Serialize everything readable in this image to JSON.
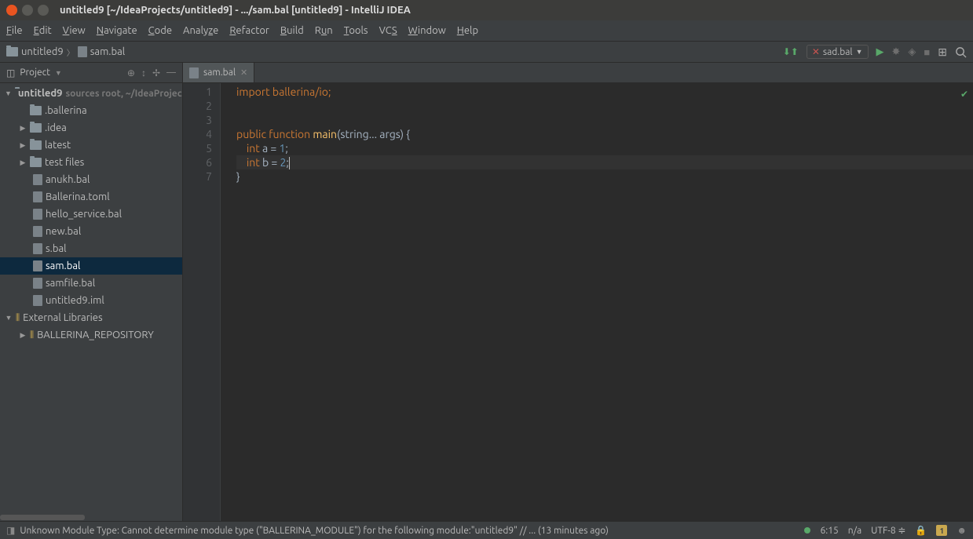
{
  "window": {
    "title": "untitled9 [~/IdeaProjects/untitled9] - .../sam.bal [untitled9] - IntelliJ IDEA"
  },
  "menubar": [
    "File",
    "Edit",
    "View",
    "Navigate",
    "Code",
    "Analyze",
    "Refactor",
    "Build",
    "Run",
    "Tools",
    "VCS",
    "Window",
    "Help"
  ],
  "breadcrumb": {
    "root": "untitled9",
    "file": "sam.bal"
  },
  "run_config": {
    "label": "sad.bal"
  },
  "project_panel": {
    "title": "Project",
    "root": {
      "name": "untitled9",
      "hint": "sources root, ~/IdeaProjects/untitled9"
    },
    "folders": [
      ".ballerina",
      ".idea",
      "latest",
      "test files"
    ],
    "files": [
      "anukh.bal",
      "Ballerina.toml",
      "hello_service.bal",
      "new.bal",
      "s.bal",
      "sam.bal",
      "samfile.bal",
      "untitled9.iml"
    ],
    "selected": "sam.bal",
    "external": "External Libraries",
    "external_child": "BALLERINA_REPOSITORY"
  },
  "tabs": {
    "active": "sam.bal"
  },
  "editor": {
    "lines": [
      "1",
      "2",
      "3",
      "4",
      "5",
      "6",
      "7"
    ],
    "code": {
      "l1": "import ballerina/io;",
      "l4_kw1": "public",
      "l4_kw2": "function",
      "l4_fn": "main",
      "l4_rest": "(string... args) {",
      "l5_kw": "int",
      "l5_rest": " a = ",
      "l5_num": "1",
      "l6_kw": "int",
      "l6_rest": " b = ",
      "l6_num": "2",
      "l7": "}"
    }
  },
  "statusbar": {
    "message": "Unknown Module Type: Cannot determine module type (\"BALLERINA_MODULE\") for the following module:\"untitled9\" // ... (13 minutes ago)",
    "pos": "6:15",
    "insert": "n/a",
    "encoding": "UTF-8",
    "warn": "1"
  }
}
